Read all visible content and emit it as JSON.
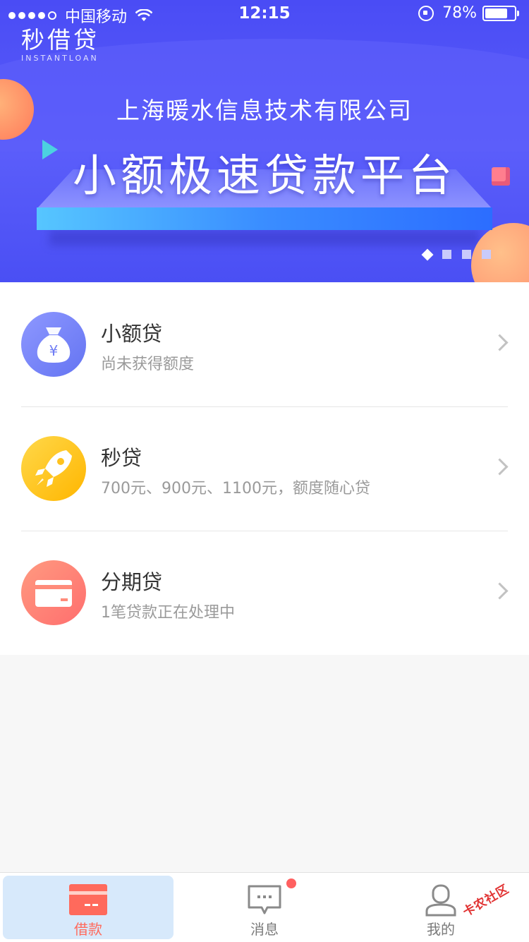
{
  "status_bar": {
    "carrier": "中国移动",
    "time": "12:15",
    "battery": "78%",
    "battery_level": 0.78
  },
  "banner": {
    "brand_name": "秒借贷",
    "brand_sub": "INSTANTLOAN",
    "company": "上海暖水信息技术有限公司",
    "slogan": "小额极速贷款平台",
    "pages": 4,
    "active_page": 1
  },
  "loans": [
    {
      "title": "小额贷",
      "subtitle": "尚未获得额度",
      "icon": "money-bag-icon"
    },
    {
      "title": "秒贷",
      "subtitle": "700元、900元、1100元，额度随心贷",
      "icon": "rocket-icon"
    },
    {
      "title": "分期贷",
      "subtitle": "1笔贷款正在处理中",
      "icon": "card-icon"
    }
  ],
  "tabbar": {
    "items": [
      {
        "label": "借款",
        "icon": "card-icon",
        "active": true,
        "color": "#ff6a5c"
      },
      {
        "label": "消息",
        "icon": "message-icon",
        "active": false,
        "color": "#7a7a7a"
      },
      {
        "label": "我的",
        "icon": "user-icon",
        "active": false,
        "color": "#7a7a7a"
      }
    ]
  },
  "watermark": "卡农社区",
  "colors": {
    "banner_bg": "#4a4cf5",
    "badge": "#ff6060",
    "active_tab": "#ff6a5c"
  }
}
